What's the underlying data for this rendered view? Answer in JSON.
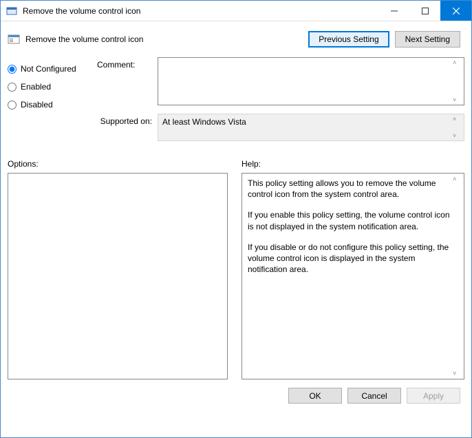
{
  "window": {
    "title": "Remove the volume control icon"
  },
  "header": {
    "policy_title": "Remove the volume control icon",
    "prev_btn": "Previous Setting",
    "next_btn": "Next Setting"
  },
  "radios": {
    "not_configured": "Not Configured",
    "enabled": "Enabled",
    "disabled": "Disabled",
    "selected": "not_configured"
  },
  "fields": {
    "comment_label": "Comment:",
    "comment_value": "",
    "supported_label": "Supported on:",
    "supported_value": "At least Windows Vista"
  },
  "panes": {
    "options_label": "Options:",
    "help_label": "Help:",
    "help_p1": "This policy setting allows you to remove the volume control icon from the system control area.",
    "help_p2": "If you enable this policy setting, the volume control icon is not displayed in the system notification area.",
    "help_p3": "If you disable or do not configure this policy setting, the volume control icon is displayed in the system notification area."
  },
  "buttons": {
    "ok": "OK",
    "cancel": "Cancel",
    "apply": "Apply"
  }
}
